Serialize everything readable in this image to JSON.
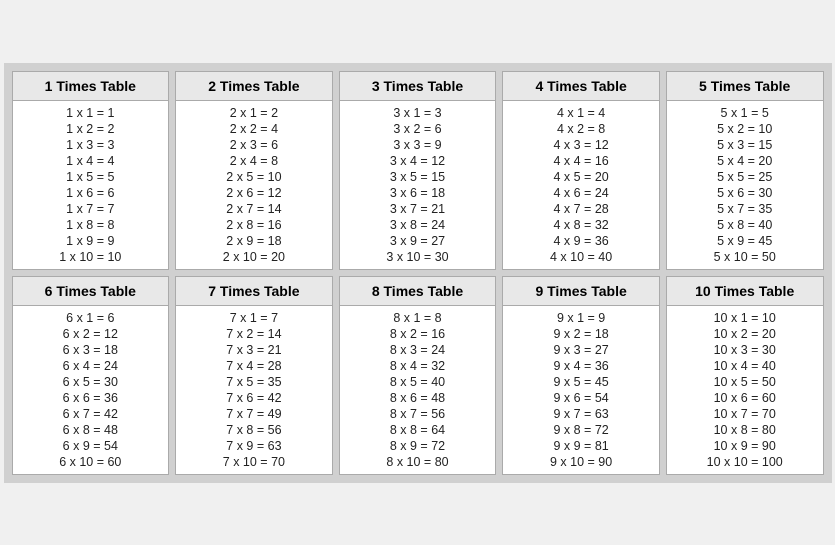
{
  "tables": [
    {
      "id": 1,
      "header": "1 Times Table",
      "rows": [
        "1 x 1 = 1",
        "1 x 2 = 2",
        "1 x 3 = 3",
        "1 x 4 = 4",
        "1 x 5 = 5",
        "1 x 6 = 6",
        "1 x 7 = 7",
        "1 x 8 = 8",
        "1 x 9 = 9",
        "1 x 10 = 10"
      ]
    },
    {
      "id": 2,
      "header": "2 Times Table",
      "rows": [
        "2 x 1 = 2",
        "2 x 2 = 4",
        "2 x 3 = 6",
        "2 x 4 = 8",
        "2 x 5 = 10",
        "2 x 6 = 12",
        "2 x 7 = 14",
        "2 x 8 = 16",
        "2 x 9 = 18",
        "2 x 10 = 20"
      ]
    },
    {
      "id": 3,
      "header": "3 Times Table",
      "rows": [
        "3 x 1 = 3",
        "3 x 2 = 6",
        "3 x 3 = 9",
        "3 x 4 = 12",
        "3 x 5 = 15",
        "3 x 6 = 18",
        "3 x 7 = 21",
        "3 x 8 = 24",
        "3 x 9 = 27",
        "3 x 10 = 30"
      ]
    },
    {
      "id": 4,
      "header": "4 Times Table",
      "rows": [
        "4 x 1 = 4",
        "4 x 2 = 8",
        "4 x 3 = 12",
        "4 x 4 = 16",
        "4 x 5 = 20",
        "4 x 6 = 24",
        "4 x 7 = 28",
        "4 x 8 = 32",
        "4 x 9 = 36",
        "4 x 10 = 40"
      ]
    },
    {
      "id": 5,
      "header": "5 Times Table",
      "rows": [
        "5 x 1 = 5",
        "5 x 2 = 10",
        "5 x 3 = 15",
        "5 x 4 = 20",
        "5 x 5 = 25",
        "5 x 6 = 30",
        "5 x 7 = 35",
        "5 x 8 = 40",
        "5 x 9 = 45",
        "5 x 10 = 50"
      ]
    },
    {
      "id": 6,
      "header": "6 Times Table",
      "rows": [
        "6 x 1 = 6",
        "6 x 2 = 12",
        "6 x 3 = 18",
        "6 x 4 = 24",
        "6 x 5 = 30",
        "6 x 6 = 36",
        "6 x 7 = 42",
        "6 x 8 = 48",
        "6 x 9 = 54",
        "6 x 10 = 60"
      ]
    },
    {
      "id": 7,
      "header": "7 Times Table",
      "rows": [
        "7 x 1 = 7",
        "7 x 2 = 14",
        "7 x 3 = 21",
        "7 x 4 = 28",
        "7 x 5 = 35",
        "7 x 6 = 42",
        "7 x 7 = 49",
        "7 x 8 = 56",
        "7 x 9 = 63",
        "7 x 10 = 70"
      ]
    },
    {
      "id": 8,
      "header": "8 Times Table",
      "rows": [
        "8 x 1 = 8",
        "8 x 2 = 16",
        "8 x 3 = 24",
        "8 x 4 = 32",
        "8 x 5 = 40",
        "8 x 6 = 48",
        "8 x 7 = 56",
        "8 x 8 = 64",
        "8 x 9 = 72",
        "8 x 10 = 80"
      ]
    },
    {
      "id": 9,
      "header": "9 Times Table",
      "rows": [
        "9 x 1 = 9",
        "9 x 2 = 18",
        "9 x 3 = 27",
        "9 x 4 = 36",
        "9 x 5 = 45",
        "9 x 6 = 54",
        "9 x 7 = 63",
        "9 x 8 = 72",
        "9 x 9 = 81",
        "9 x 10 = 90"
      ]
    },
    {
      "id": 10,
      "header": "10 Times Table",
      "rows": [
        "10 x 1 = 10",
        "10 x 2 = 20",
        "10 x 3 = 30",
        "10 x 4 = 40",
        "10 x 5 = 50",
        "10 x 6 = 60",
        "10 x 7 = 70",
        "10 x 8 = 80",
        "10 x 9 = 90",
        "10 x 10 = 100"
      ]
    }
  ]
}
